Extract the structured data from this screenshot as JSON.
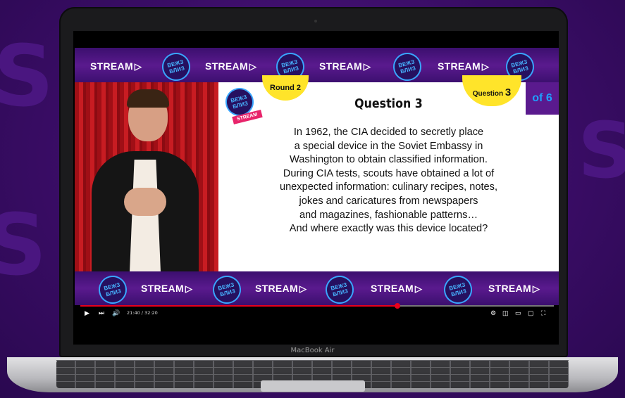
{
  "background": {
    "color": "#3a0d66"
  },
  "laptop": {
    "model_label": "MacBook Air"
  },
  "banner": {
    "stream_label": "STREAM",
    "badge_text": "ВЕЖЗ\nБЛИЗ"
  },
  "quiz": {
    "round_label": "Round 2",
    "question_tab_label": "Question",
    "question_tab_number": "3",
    "of_total": "of 6",
    "title": "Question 3",
    "stream_tag": "STREAM",
    "question_lines": [
      "In 1962, the CIA decided to secretly place",
      "a special device in the Soviet Embassy in",
      "Washington to obtain classified information.",
      "During CIA tests, scouts have obtained a lot of",
      "unexpected information: culinary recipes, notes,",
      "jokes and caricatures from newspapers",
      "and magazines, fashionable patterns…",
      "And where exactly was this device located?"
    ]
  },
  "player": {
    "time": "21:40 / 32:20",
    "progress": 0.67,
    "accent_color": "#e8001c"
  }
}
